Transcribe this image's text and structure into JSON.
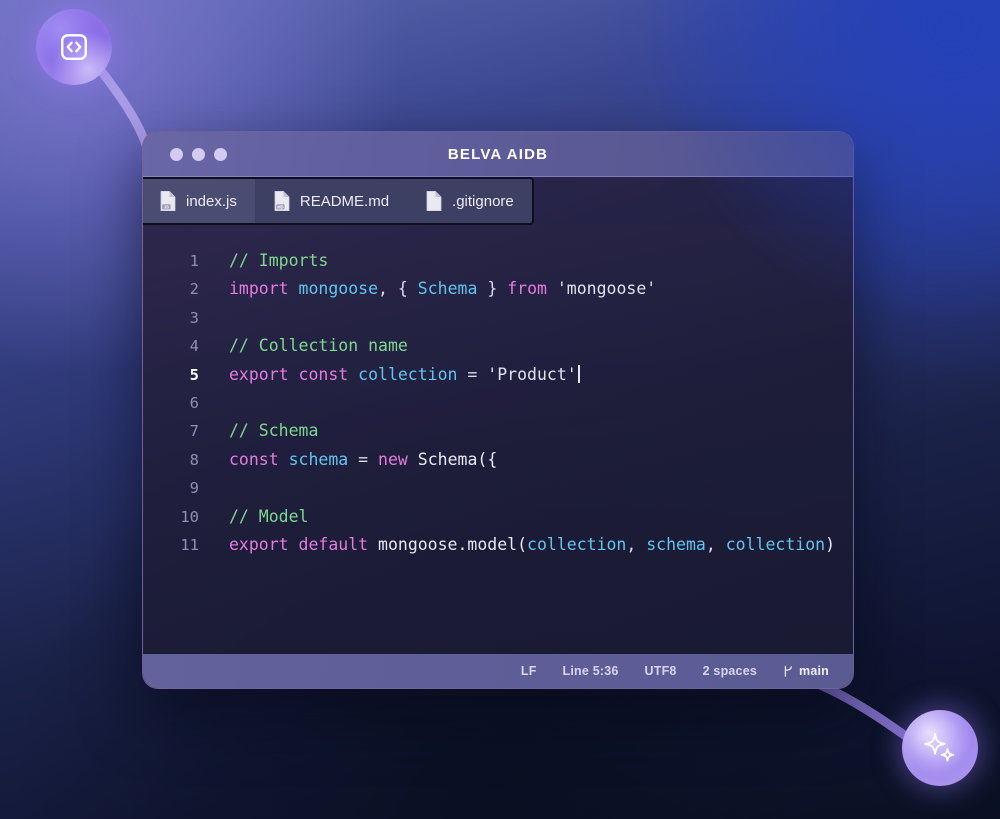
{
  "window": {
    "title": "BELVA AIDB",
    "traffic_lights": [
      "close",
      "minimize",
      "maximize"
    ]
  },
  "tabs": [
    {
      "label": "index.js",
      "icon": "js-file-icon",
      "icon_text": "JS",
      "active": true
    },
    {
      "label": "README.md",
      "icon": "markdown-file-icon",
      "icon_text": "MD",
      "active": false
    },
    {
      "label": ".gitignore",
      "icon": "plain-file-icon",
      "icon_text": "",
      "active": false
    }
  ],
  "editor": {
    "current_line": 5,
    "lines": [
      {
        "n": "1",
        "tokens": [
          {
            "t": "comment",
            "v": "// Imports"
          }
        ]
      },
      {
        "n": "2",
        "tokens": [
          {
            "t": "keyword",
            "v": "import "
          },
          {
            "t": "ident",
            "v": "mongoose"
          },
          {
            "t": "punct",
            "v": ", { "
          },
          {
            "t": "ident",
            "v": "Schema"
          },
          {
            "t": "punct",
            "v": " } "
          },
          {
            "t": "keyword",
            "v": "from "
          },
          {
            "t": "string",
            "v": "'mongoose'"
          }
        ]
      },
      {
        "n": "3",
        "tokens": []
      },
      {
        "n": "4",
        "tokens": [
          {
            "t": "comment",
            "v": "// Collection name"
          }
        ]
      },
      {
        "n": "5",
        "tokens": [
          {
            "t": "keyword",
            "v": "export const "
          },
          {
            "t": "ident",
            "v": "collection"
          },
          {
            "t": "punct",
            "v": " = "
          },
          {
            "t": "string",
            "v": "'Product'"
          },
          {
            "t": "caret",
            "v": ""
          }
        ]
      },
      {
        "n": "6",
        "tokens": []
      },
      {
        "n": "7",
        "tokens": [
          {
            "t": "comment",
            "v": "// Schema"
          }
        ]
      },
      {
        "n": "8",
        "tokens": [
          {
            "t": "keyword",
            "v": "const "
          },
          {
            "t": "ident",
            "v": "schema"
          },
          {
            "t": "punct",
            "v": " = "
          },
          {
            "t": "keyword",
            "v": "new "
          },
          {
            "t": "plain",
            "v": "Schema({"
          }
        ]
      },
      {
        "n": "9",
        "tokens": []
      },
      {
        "n": "10",
        "tokens": [
          {
            "t": "comment",
            "v": "// Model"
          }
        ]
      },
      {
        "n": "11",
        "tokens": [
          {
            "t": "keyword",
            "v": "export default "
          },
          {
            "t": "plain",
            "v": "mongoose.model("
          },
          {
            "t": "ident",
            "v": "collection"
          },
          {
            "t": "punct",
            "v": ", "
          },
          {
            "t": "ident",
            "v": "schema"
          },
          {
            "t": "punct",
            "v": ", "
          },
          {
            "t": "ident",
            "v": "collection"
          },
          {
            "t": "plain",
            "v": ")"
          }
        ]
      }
    ]
  },
  "status_bar": {
    "line_ending": "LF",
    "cursor_position": "Line 5:36",
    "encoding": "UTF8",
    "indentation": "2 spaces",
    "branch": "main",
    "branch_icon": "git-branch-icon"
  },
  "badges": {
    "top_left": {
      "icon": "code-brackets-icon",
      "glyph": "<>"
    },
    "bottom_right": {
      "icon": "sparkles-icon",
      "glyph": "✦"
    }
  },
  "colors": {
    "accent_purple": "#8b6fe8",
    "title_bar": "#625f9e",
    "tab_active": "#4b4c72",
    "comment": "#7fd88f",
    "keyword": "#e57be0",
    "identifier": "#62c4f0",
    "string": "#e2e2ee",
    "bg_top_left": "#5f6cb4",
    "bg_top_right": "#2b4199",
    "bg_bottom": "#0a1022"
  }
}
